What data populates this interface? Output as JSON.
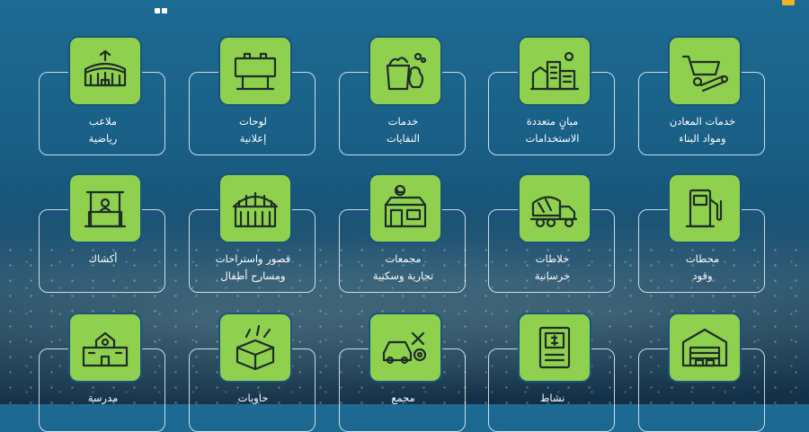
{
  "colors": {
    "accent": "#8fd14f",
    "background": "#1a5f86",
    "text": "#ffffff"
  },
  "tiles": [
    {
      "row": 0,
      "icon": "stadium-icon",
      "line1": "ملاعب",
      "line2": "رياضية"
    },
    {
      "row": 0,
      "icon": "billboard-icon",
      "line1": "لوحات",
      "line2": "إعلانية"
    },
    {
      "row": 0,
      "icon": "waste-icon",
      "line1": "خدمات",
      "line2": "النفايات"
    },
    {
      "row": 0,
      "icon": "buildings-icon",
      "line1": "مبانٍ متعددة",
      "line2": "الاستخدامات"
    },
    {
      "row": 0,
      "icon": "wheelbarrow-icon",
      "line1": "خدمات المعادن",
      "line2": "ومواد البناء"
    },
    {
      "row": 1,
      "icon": "kiosk-icon",
      "line1": "أكشاك",
      "line2": ""
    },
    {
      "row": 1,
      "icon": "hall-icon",
      "line1": "قصور واستراحات",
      "line2": "ومسارح أطفال"
    },
    {
      "row": 1,
      "icon": "store-icon",
      "line1": "مجمعات",
      "line2": "تجارية وسكنية"
    },
    {
      "row": 1,
      "icon": "mixer-truck-icon",
      "line1": "خلاطات",
      "line2": "خرسانية"
    },
    {
      "row": 1,
      "icon": "fuel-pump-icon",
      "line1": "محطات",
      "line2": "وقود"
    },
    {
      "row": 2,
      "icon": "school-icon",
      "line1": "مدرسة",
      "line2": ""
    },
    {
      "row": 2,
      "icon": "box-icon",
      "line1": "حاويات",
      "line2": ""
    },
    {
      "row": 2,
      "icon": "car-service-icon",
      "line1": "مجمع",
      "line2": ""
    },
    {
      "row": 2,
      "icon": "atm-icon",
      "line1": "نشاط",
      "line2": ""
    },
    {
      "row": 2,
      "icon": "warehouse-icon",
      "line1": "",
      "line2": ""
    }
  ]
}
